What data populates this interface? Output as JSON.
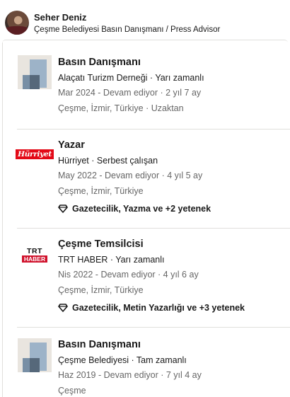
{
  "header": {
    "name": "Seher Deniz",
    "headline": "Çeşme Belediyesi Basın Danışmanı / Press Advisor"
  },
  "experience": [
    {
      "logo": "placeholder-logo",
      "title": "Basın Danışmanı",
      "company": "Alaçatı Turizm Derneği · Yarı zamanlı",
      "dates": "Mar 2024 - Devam ediyor · 2 yıl 7 ay",
      "location": "Çeşme, İzmir, Türkiye · Uzaktan"
    },
    {
      "logo": "hurriyet-logo",
      "logo_text": "Hürriyet",
      "title": "Yazar",
      "company": "Hürriyet · Serbest çalışan",
      "dates": "May 2022 - Devam ediyor · 4 yıl 5 ay",
      "location": "Çeşme, İzmir, Türkiye",
      "skills": "Gazetecilik, Yazma ve +2 yetenek"
    },
    {
      "logo": "trt-haber-logo",
      "logo_text_top": "TRT",
      "logo_text_bottom": "HABER",
      "title": "Çeşme Temsilcisi",
      "company": "TRT HABER · Yarı zamanlı",
      "dates": "Nis 2022 - Devam ediyor · 4 yıl 6 ay",
      "location": "Çeşme, İzmir, Türkiye",
      "skills": "Gazetecilik, Metin Yazarlığı ve +3 yetenek"
    },
    {
      "logo": "placeholder-logo",
      "title": "Basın Danışmanı",
      "company": "Çeşme Belediyesi · Tam zamanlı",
      "dates": "Haz 2019 - Devam ediyor · 7 yıl 4 ay",
      "location": "Çeşme"
    }
  ],
  "colors": {
    "text_primary": "#191919",
    "text_muted": "#666666",
    "divider": "#e0dfdc",
    "hurriyet_red": "#e30a17",
    "trt_red": "#d0112b"
  }
}
